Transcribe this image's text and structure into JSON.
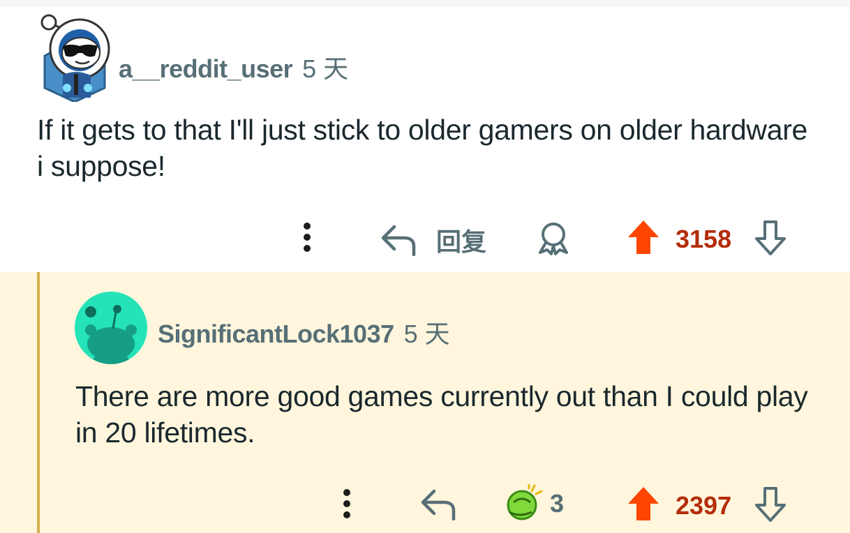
{
  "comment": {
    "username": "a__reddit_user",
    "time": "5 天",
    "text": "If it gets to that I'll just stick to older gamers on older hardware i suppose!",
    "reply_label": "回复",
    "votes": "3158"
  },
  "reply": {
    "username": "SignificantLock1037",
    "time": "5 天",
    "text": "There are more good games currently out than I could play in 20 lifetimes.",
    "award_count": "3",
    "votes": "2397"
  },
  "colors": {
    "upvote": "#ff4500",
    "vote_text": "#b32d0a",
    "meta": "#576f76",
    "nested_bg": "#fff6dd",
    "thread_line": "#d3b14f"
  },
  "icons": {
    "more": "more-vertical-icon",
    "reply": "reply-arrow-icon",
    "award": "award-ribbon-icon",
    "upvote": "upvote-arrow-icon",
    "downvote": "downvote-arrow-icon",
    "award_emoji": "green-award-emoji-icon"
  }
}
